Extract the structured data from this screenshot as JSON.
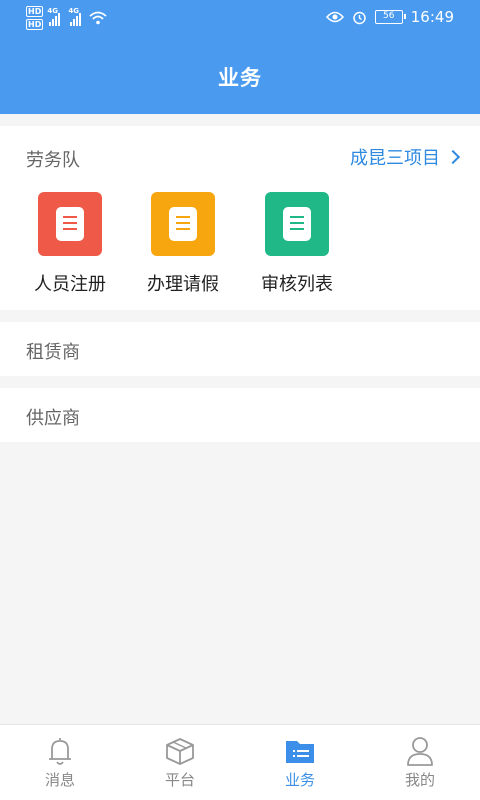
{
  "status": {
    "hd1": "HD",
    "hd2": "HD",
    "net1": "4G",
    "net2": "4G",
    "battery": "56",
    "time": "16:49",
    "icons": [
      "eye-icon",
      "alarm-icon"
    ]
  },
  "header": {
    "title": "业务"
  },
  "labor": {
    "title": "劳务队",
    "project": "成昆三项目",
    "tiles": [
      {
        "label": "人员注册",
        "color": "#ee5a47",
        "icon": "document-icon"
      },
      {
        "label": "办理请假",
        "color": "#f7a60f",
        "icon": "document-icon"
      },
      {
        "label": "审核列表",
        "color": "#1fb886",
        "icon": "document-icon"
      }
    ]
  },
  "lessor": {
    "title": "租赁商"
  },
  "supplier": {
    "title": "供应商"
  },
  "tabs": [
    {
      "label": "消息",
      "icon": "bell-icon",
      "active": false
    },
    {
      "label": "平台",
      "icon": "box-icon",
      "active": false
    },
    {
      "label": "业务",
      "icon": "folder-icon",
      "active": true
    },
    {
      "label": "我的",
      "icon": "user-icon",
      "active": false
    }
  ],
  "colors": {
    "primary": "#4a9bf0",
    "accent": "#2f8ae0",
    "background": "#f5f5f5"
  }
}
